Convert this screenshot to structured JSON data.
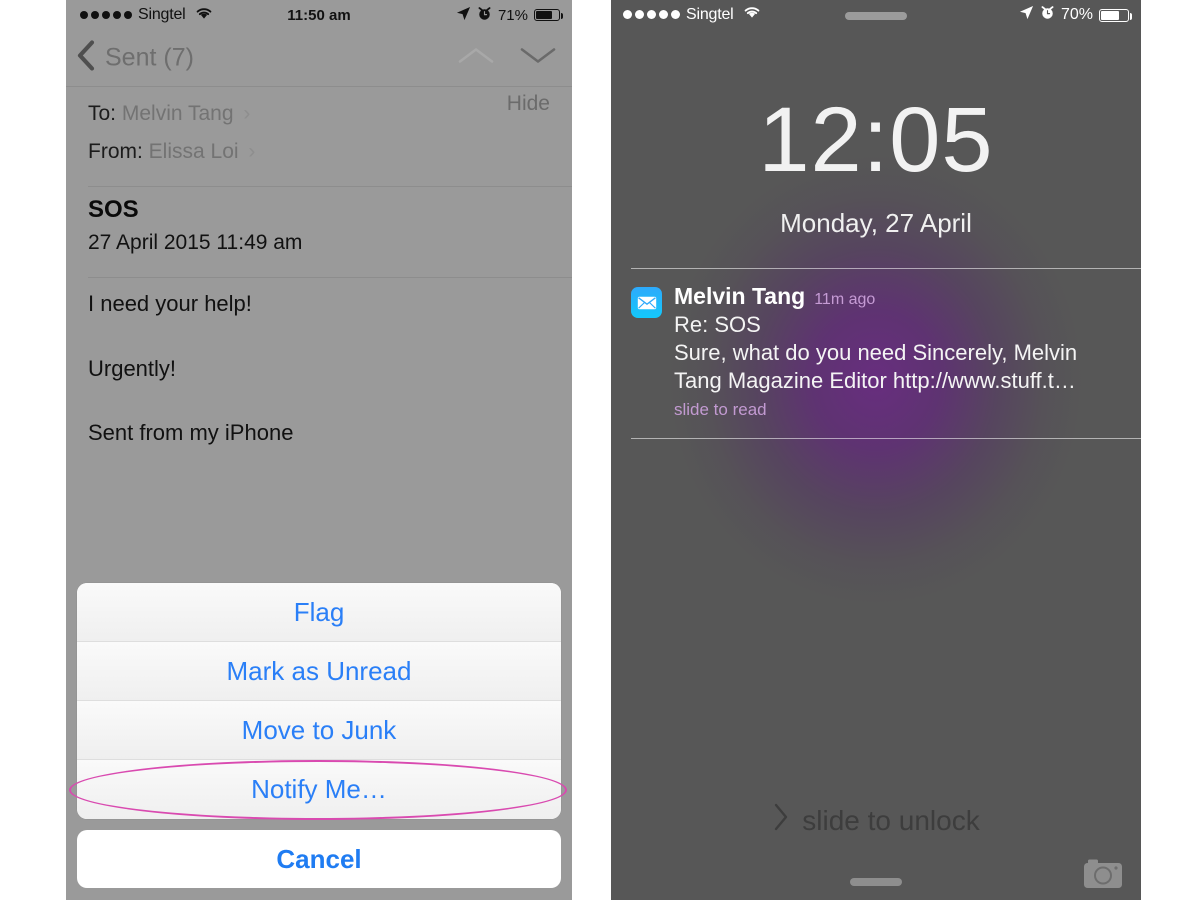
{
  "left_phone": {
    "status_bar": {
      "signal_dots": 5,
      "carrier": "Singtel",
      "wifi_icon": "wifi-icon",
      "time": "11:50 am",
      "location_icon": "location-arrow-icon",
      "alarm_icon": "alarm-clock-icon",
      "battery_percent": "71%",
      "battery_level": 71
    },
    "nav_bar": {
      "back_icon": "chevron-left-icon",
      "back_label": "Sent (7)",
      "prev_message_icon": "chevron-up-icon",
      "next_message_icon": "chevron-down-icon"
    },
    "mail_header": {
      "to_label": "To:",
      "to_value": "Melvin Tang",
      "from_label": "From:",
      "from_value": "Elissa Loi",
      "disclosure_icon": "chevron-right-icon",
      "hide_label": "Hide",
      "subject": "SOS",
      "date": "27 April 2015 11:49 am"
    },
    "mail_body": [
      "I need your help!",
      "Urgently!",
      "Sent from my iPhone"
    ],
    "action_sheet": {
      "items": [
        {
          "label": "Flag"
        },
        {
          "label": "Mark as Unread"
        },
        {
          "label": "Move to Junk"
        },
        {
          "label": "Notify Me…"
        }
      ],
      "cancel_label": "Cancel",
      "highlight_color": "#d94ab0",
      "tint_color": "#2a7ff7"
    }
  },
  "right_phone": {
    "status_bar": {
      "signal_dots": 5,
      "carrier": "Singtel",
      "wifi_icon": "wifi-icon",
      "location_icon": "location-arrow-icon",
      "alarm_icon": "alarm-clock-icon",
      "battery_percent": "70%",
      "battery_level": 70
    },
    "lock_screen": {
      "time": "12:05",
      "date": "Monday, 27 April",
      "slide_to_unlock_label": "slide to unlock",
      "slide_chevron_icon": "chevron-right-icon",
      "camera_icon": "camera-icon",
      "home_indicator": "home-indicator"
    },
    "notification": {
      "app_icon": "mail-icon",
      "sender": "Melvin Tang",
      "time_ago": "11m ago",
      "subject": "Re: SOS",
      "preview": "Sure, what do you need Sincerely, Melvin Tang Magazine Editor http://www.stuff.t…",
      "action_hint": "slide to read"
    }
  }
}
